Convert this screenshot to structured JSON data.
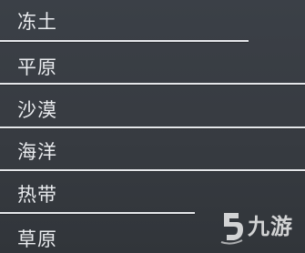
{
  "list": {
    "items": [
      {
        "label": "冻土"
      },
      {
        "label": "平原"
      },
      {
        "label": "沙漠"
      },
      {
        "label": "海洋"
      },
      {
        "label": "热带"
      },
      {
        "label": "草原"
      }
    ]
  },
  "watermark": {
    "text": "九游",
    "icon": "jiuyou-logo-icon"
  }
}
